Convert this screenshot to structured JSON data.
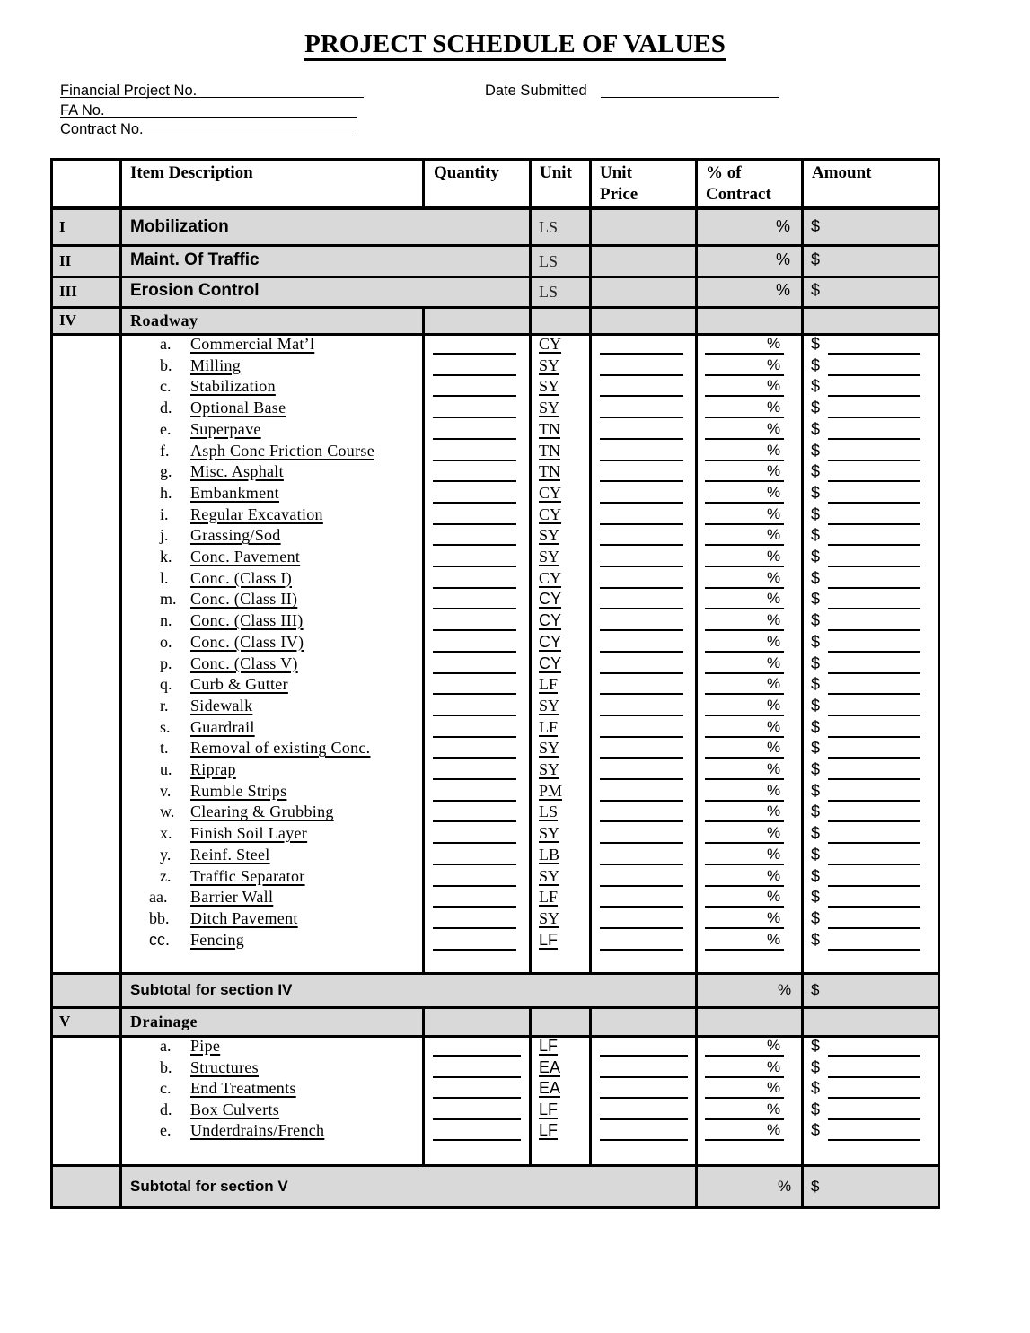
{
  "document": {
    "title": "PROJECT SCHEDULE OF VALUES",
    "fields": {
      "financial_project_no": "Financial Project No.",
      "fa_no": "FA No.",
      "contract_no": "Contract No.",
      "date_submitted": "Date Submitted"
    }
  },
  "table": {
    "headers": {
      "item_description": "Item Description",
      "quantity": "Quantity",
      "unit": "Unit",
      "unit_price": "Unit Price",
      "unit_price_line1": "Unit",
      "unit_price_line2": "Price",
      "pct_contract_line1": "% of",
      "pct_contract_line2": "Contract",
      "amount": "Amount"
    },
    "symbols": {
      "percent": "%",
      "dollar": "$"
    },
    "lump_sections": [
      {
        "numeral": "I",
        "title": "Mobilization",
        "unit": "LS"
      },
      {
        "numeral": "II",
        "title": "Maint. Of Traffic",
        "unit": "LS"
      },
      {
        "numeral": "III",
        "title": "Erosion Control",
        "unit": "LS"
      }
    ],
    "section_iv": {
      "numeral": "IV",
      "title": "Roadway",
      "subtotal_label": "Subtotal for section IV",
      "items": [
        {
          "letter": "a.",
          "description": "Commercial Mat’l",
          "unit": "CY"
        },
        {
          "letter": "b.",
          "description": "Milling",
          "unit": "SY"
        },
        {
          "letter": "c.",
          "description": "Stabilization",
          "unit": "SY"
        },
        {
          "letter": "d.",
          "description": "Optional Base",
          "unit": "SY"
        },
        {
          "letter": "e.",
          "description": "Superpave",
          "unit": "TN"
        },
        {
          "letter": "f.",
          "description": "Asph Conc Friction Course",
          "unit": "TN"
        },
        {
          "letter": "g.",
          "description": "Misc. Asphalt",
          "unit": "TN"
        },
        {
          "letter": "h.",
          "description": "Embankment",
          "unit": "CY"
        },
        {
          "letter": "i.",
          "description": "Regular Excavation",
          "unit": "CY"
        },
        {
          "letter": "j.",
          "description": "Grassing/Sod",
          "unit": "SY"
        },
        {
          "letter": "k.",
          "description": "Conc. Pavement",
          "unit": "SY"
        },
        {
          "letter": "l.",
          "description": "Conc. (Class I)",
          "unit": "CY"
        },
        {
          "letter": "m.",
          "description": "Conc. (Class II)",
          "unit": "CY"
        },
        {
          "letter": "n.",
          "description": "Conc. (Class III)",
          "unit": "CY"
        },
        {
          "letter": "o.",
          "description": "Conc. (Class IV)",
          "unit": "CY"
        },
        {
          "letter": "p.",
          "description": "Conc. (Class V)",
          "unit": "CY"
        },
        {
          "letter": "q.",
          "description": "Curb & Gutter",
          "unit": "LF"
        },
        {
          "letter": "r.",
          "description": "Sidewalk",
          "unit": "SY"
        },
        {
          "letter": "s.",
          "description": "Guardrail",
          "unit": "LF"
        },
        {
          "letter": "t.",
          "description": "Removal of existing Conc.",
          "unit": "SY"
        },
        {
          "letter": "u.",
          "description": "Riprap",
          "unit": "SY"
        },
        {
          "letter": "v.",
          "description": "Rumble Strips",
          "unit": "PM"
        },
        {
          "letter": "w.",
          "description": "Clearing & Grubbing",
          "unit": "LS"
        },
        {
          "letter": "x.",
          "description": "Finish Soil Layer",
          "unit": "SY"
        },
        {
          "letter": "y.",
          "description": "Reinf. Steel",
          "unit": "LB"
        },
        {
          "letter": "z.",
          "description": "Traffic Separator",
          "unit": "SY"
        },
        {
          "letter": "aa.",
          "description": "Barrier Wall",
          "unit": "LF"
        },
        {
          "letter": "bb.",
          "description": "Ditch Pavement",
          "unit": "SY"
        },
        {
          "letter": "cc.",
          "description": "Fencing",
          "unit": "LF"
        }
      ]
    },
    "section_v": {
      "numeral": "V",
      "title": "Drainage",
      "subtotal_label": "Subtotal for section V",
      "items": [
        {
          "letter": "a.",
          "description": "Pipe",
          "unit": "LF"
        },
        {
          "letter": "b.",
          "description": "Structures",
          "unit": "EA"
        },
        {
          "letter": "c.",
          "description": "End Treatments",
          "unit": "EA"
        },
        {
          "letter": "d.",
          "description": "Box Culverts",
          "unit": "LF"
        },
        {
          "letter": "e.",
          "description": "Underdrains/French",
          "unit": "LF"
        }
      ]
    }
  }
}
